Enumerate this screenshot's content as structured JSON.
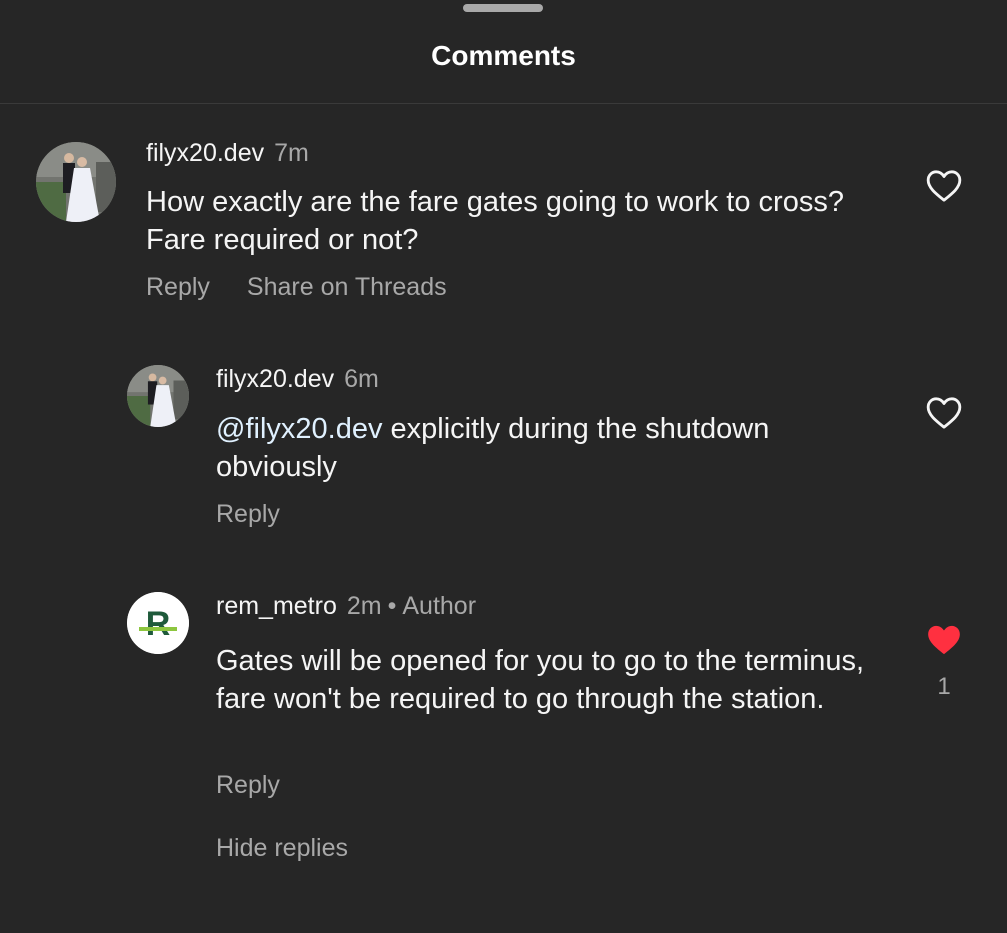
{
  "header": {
    "title": "Comments"
  },
  "comments": [
    {
      "username": "filyx20.dev",
      "time": "7m",
      "text": "How exactly are the fare gates going to work to cross? Fare required or not?",
      "reply_label": "Reply",
      "share_label": "Share on Threads",
      "liked": false
    },
    {
      "username": "filyx20.dev",
      "time": "6m",
      "mention": "@filyx20.dev",
      "text": " explicitly during the shutdown obviously",
      "reply_label": "Reply",
      "liked": false
    },
    {
      "username": "rem_metro",
      "time": "2m",
      "separator": "•",
      "badge": "Author",
      "text": "Gates will be opened for you to go to the terminus, fare won't be required to go through the station.",
      "reply_label": "Reply",
      "liked": true,
      "like_count": "1",
      "avatar_letter": "R"
    }
  ],
  "hide_replies_label": "Hide replies",
  "colors": {
    "background": "#262626",
    "text": "#f5f5f5",
    "muted": "#a8a8a8",
    "like_active": "#ff3040",
    "brand_green": "#1f5a3b",
    "brand_lime": "#8dc63f"
  }
}
